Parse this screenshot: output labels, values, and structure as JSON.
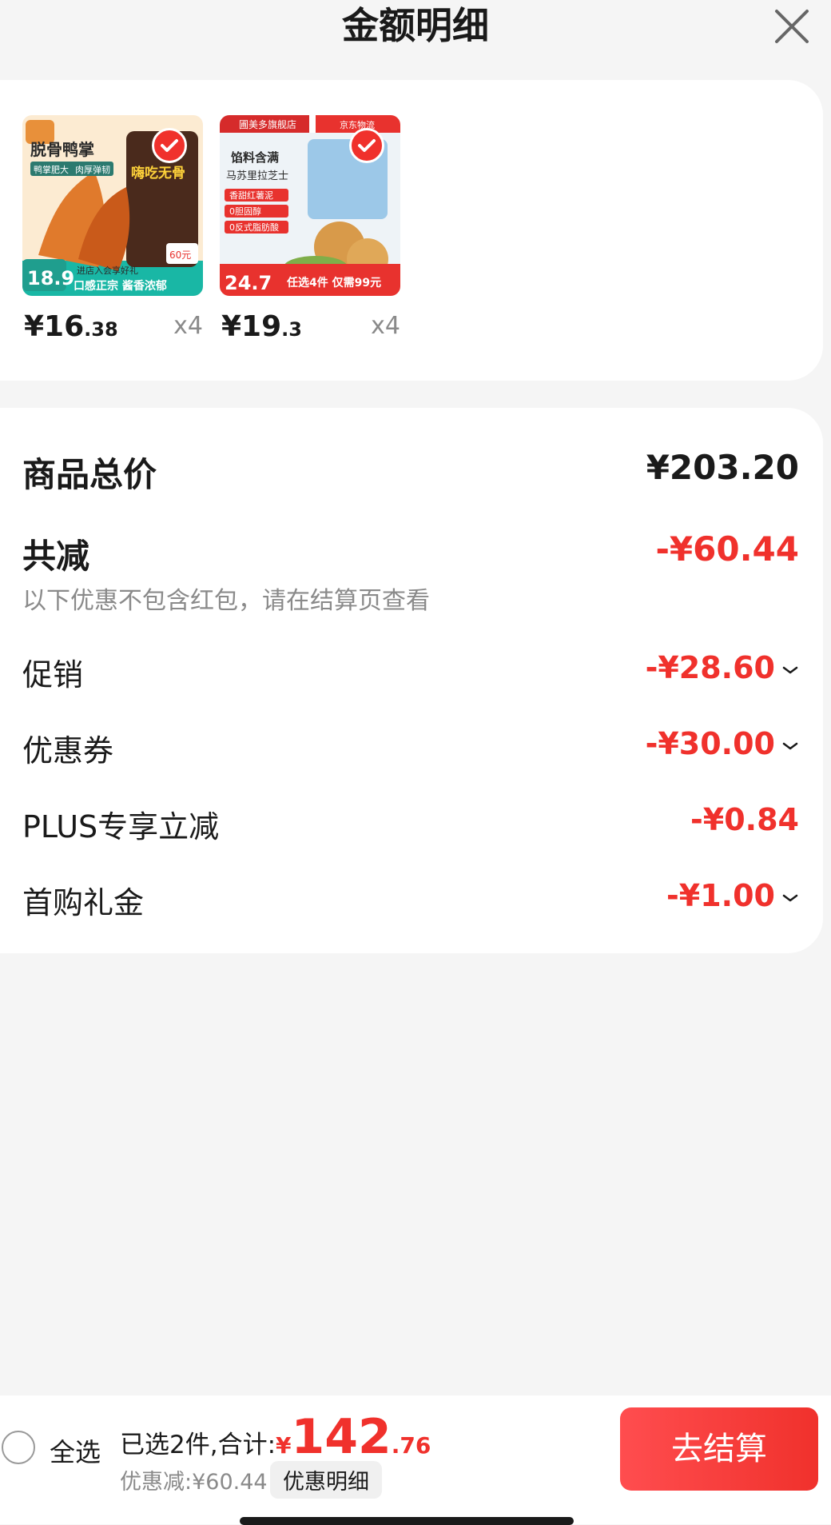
{
  "header": {
    "title": "金额明细"
  },
  "products": [
    {
      "price_int": "¥16",
      "price_dec": ".38",
      "qty": "x4",
      "image_text": {
        "title": "脱骨鸭掌",
        "tag1": "鸭掌肥大",
        "tag2": "肉厚弹韧",
        "side": "嗨吃无骨",
        "price_badge": "18.9",
        "bottom": "口感正宗 酱香浓郁",
        "promo": "进店入会享好礼",
        "coupon": "60元"
      },
      "colors": {
        "top": "#fcebd2",
        "bottom": "#19b7a5"
      }
    },
    {
      "price_int": "¥19",
      "price_dec": ".3",
      "qty": "x4",
      "image_text": {
        "store": "圃美多旗舰店",
        "logistics": "京东物流",
        "filling": "馅料含满",
        "cheese": "马苏里拉芝士",
        "t1": "香甜红薯泥",
        "t2": "0胆固醇",
        "t3": "0反式脂肪酸",
        "price_badge": "24.7",
        "promo": "任选4件 仅需99元"
      },
      "colors": {
        "top": "#eef3f7",
        "bottom": "#e8322e"
      }
    }
  ],
  "summary": {
    "total_label": "商品总价",
    "total_value": "¥203.20",
    "reduce_label": "共减",
    "reduce_value": "-¥60.44",
    "note": "以下优惠不包含红包，请在结算页查看",
    "items": [
      {
        "label": "促销",
        "value": "-¥28.60",
        "expandable": true
      },
      {
        "label": "优惠券",
        "value": "-¥30.00",
        "expandable": true
      },
      {
        "label": "PLUS专享立减",
        "value": "-¥0.84",
        "expandable": false
      },
      {
        "label": "首购礼金",
        "value": "-¥1.00",
        "expandable": true
      }
    ]
  },
  "bottom_bar": {
    "select_all": "全选",
    "selected_text": "已选2件,合计:",
    "currency": "¥",
    "total_int": "142",
    "total_dec": ".76",
    "discount_text": "优惠减:¥60.44",
    "detail_button": "优惠明细",
    "checkout_button": "去结算"
  },
  "theme": {
    "accent": "#f0312c",
    "text": "#1a1a1a",
    "muted": "#8a8a8a",
    "background": "#f5f5f5"
  }
}
